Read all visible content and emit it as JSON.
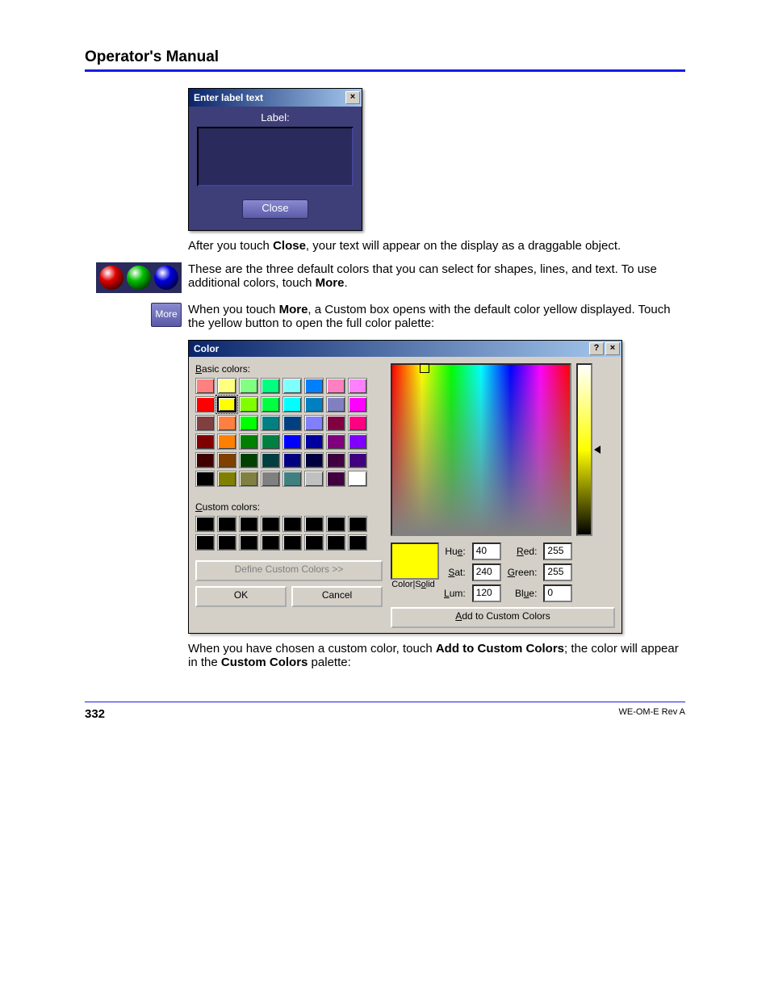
{
  "header": {
    "title": "Operator's Manual"
  },
  "labelDialog": {
    "title": "Enter label text",
    "fieldLabel": "Label:",
    "closeLabel": "Close"
  },
  "para1_a": "After you touch ",
  "para1_bold": "Close",
  "para1_b": ", your text will appear on the display as a draggable object.",
  "para2_a": "These are the three default colors that you can select for shapes, lines, and text. To use additional colors, touch ",
  "para2_bold": "More",
  "para2_b": ".",
  "moreButtonLabel": "More",
  "para3_a": "When you touch ",
  "para3_bold": "More",
  "para3_b": ", a Custom box opens with the default color yellow displayed. Touch the yellow button to open the full color palette:",
  "colorDialog": {
    "title": "Color",
    "basicLabel": "Basic colors:",
    "customLabel": "Custom colors:",
    "defineLabel": "Define Custom Colors >>",
    "okLabel": "OK",
    "cancelLabel": "Cancel",
    "colorSolidLabel": "Color|Solid",
    "addLabel": "Add to Custom Colors",
    "basicColors": [
      "#ff8080",
      "#ffff80",
      "#80ff80",
      "#00ff80",
      "#80ffff",
      "#0080ff",
      "#ff80c0",
      "#ff80ff",
      "#ff0000",
      "#ffff00",
      "#80ff00",
      "#00ff40",
      "#00ffff",
      "#0080c0",
      "#8080c0",
      "#ff00ff",
      "#804040",
      "#ff8040",
      "#00ff00",
      "#008080",
      "#004080",
      "#8080ff",
      "#800040",
      "#ff0080",
      "#800000",
      "#ff8000",
      "#008000",
      "#008040",
      "#0000ff",
      "#0000a0",
      "#800080",
      "#8000ff",
      "#400000",
      "#804000",
      "#004000",
      "#004040",
      "#000080",
      "#000040",
      "#400040",
      "#400080",
      "#000000",
      "#808000",
      "#808040",
      "#808080",
      "#408080",
      "#c0c0c0",
      "#400040",
      "#ffffff"
    ],
    "selectedIndex": 9,
    "customSlots": 16,
    "hue": "40",
    "sat": "240",
    "lum": "120",
    "red": "255",
    "green": "255",
    "blue": "0"
  },
  "para4_a": "When you have chosen a custom color, touch ",
  "para4_bold1": "Add to Custom Colors",
  "para4_b": "; the color will appear in the ",
  "para4_bold2": "Custom Colors",
  "para4_c": " palette:",
  "footer": {
    "pageNum": "332",
    "docId": "WE-OM-E Rev A"
  }
}
